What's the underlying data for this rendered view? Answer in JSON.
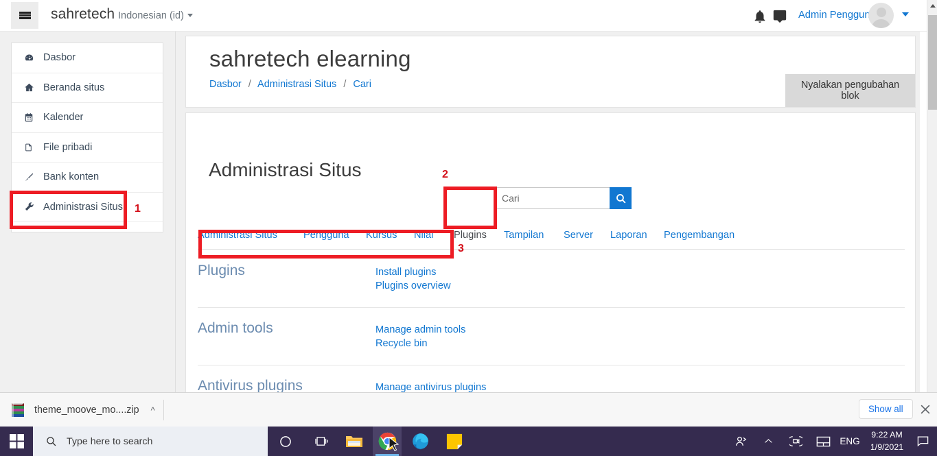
{
  "browser": {
    "navbar": {
      "hamburger_icon": "hamburger-icon",
      "brand": "sahretech",
      "language": "Indonesian (id)",
      "bell_icon": "bell-icon",
      "message_icon": "message-icon",
      "username": "Admin Pengguna",
      "avatar_icon": "avatar",
      "user_caret_icon": "chevron-down-icon"
    },
    "sidebar": {
      "items": [
        {
          "label": "Dasbor",
          "icon": "dashboard-icon"
        },
        {
          "label": "Beranda situs",
          "icon": "home-icon"
        },
        {
          "label": "Kalender",
          "icon": "calendar-icon"
        },
        {
          "label": "File pribadi",
          "icon": "file-icon"
        },
        {
          "label": "Bank konten",
          "icon": "brush-icon"
        },
        {
          "label": "Administrasi Situs",
          "icon": "wrench-icon"
        }
      ]
    },
    "header": {
      "title": "sahretech elearning",
      "breadcrumb": [
        "Dasbor",
        "Administrasi Situs",
        "Cari"
      ],
      "breadcrumb_separator": "/",
      "block_edit_button": "Nyalakan pengubahan blok"
    },
    "content": {
      "section_title": "Administrasi Situs",
      "search": {
        "placeholder": "Cari",
        "value": "",
        "button_icon": "search-icon"
      },
      "tabs": [
        {
          "label": "Administrasi Situs",
          "active": false
        },
        {
          "label": "Pengguna",
          "active": false
        },
        {
          "label": "Kursus",
          "active": false
        },
        {
          "label": "Nilai",
          "active": false
        },
        {
          "label": "Plugins",
          "active": true
        },
        {
          "label": "Tampilan",
          "active": false
        },
        {
          "label": "Server",
          "active": false
        },
        {
          "label": "Laporan",
          "active": false
        },
        {
          "label": "Pengembangan",
          "active": false
        }
      ],
      "sections": [
        {
          "name": "Plugins",
          "links": [
            "Install plugins",
            "Plugins overview"
          ]
        },
        {
          "name": "Admin tools",
          "links": [
            "Manage admin tools",
            "Recycle bin"
          ]
        },
        {
          "name": "Antivirus plugins",
          "links": [
            "Manage antivirus plugins"
          ]
        }
      ]
    },
    "annotations": [
      {
        "number": "1"
      },
      {
        "number": "2"
      },
      {
        "number": "3"
      }
    ],
    "annotation_color": "#ed1c24"
  },
  "download_bar": {
    "file_name": "theme_moove_mo....zip",
    "file_icon": "archive-icon",
    "caret_icon": "chevron-up-icon",
    "show_all_label": "Show all",
    "close_icon": "close-icon"
  },
  "taskbar": {
    "start_icon": "windows-start-icon",
    "search_placeholder": "Type here to search",
    "search_icon": "magnifier-icon",
    "items": [
      {
        "name": "cortana-icon"
      },
      {
        "name": "task-view-icon"
      },
      {
        "name": "file-explorer-icon"
      },
      {
        "name": "chrome-icon"
      },
      {
        "name": "edge-icon"
      },
      {
        "name": "sticky-notes-icon"
      }
    ],
    "tray": {
      "people_icon": "people-icon",
      "chevron_icon": "chevron-up-icon",
      "camera_icon": "camera-icon",
      "touchpad_icon": "touchpad-icon",
      "language": "ENG",
      "time": "9:22 AM",
      "date": "1/9/2021",
      "notification_icon": "notification-icon"
    }
  }
}
